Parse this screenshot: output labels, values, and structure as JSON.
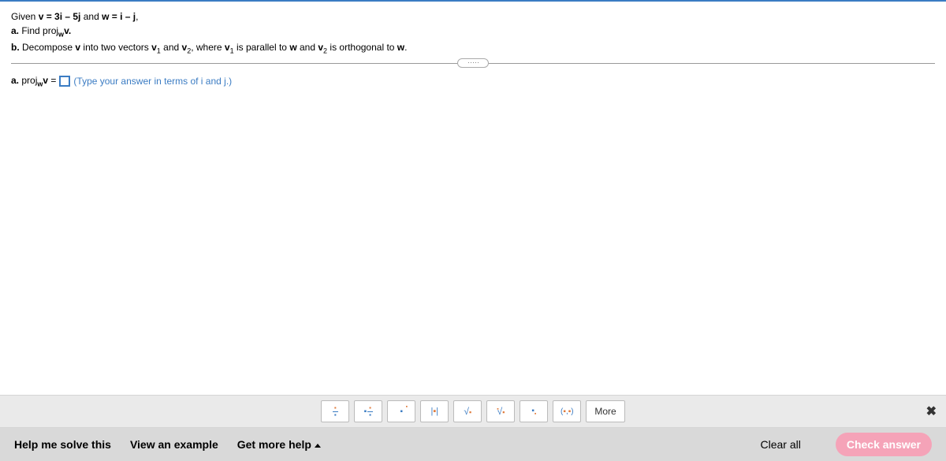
{
  "question": {
    "given_prefix": "Given ",
    "given_v_eq": "v = 3i – 5j",
    "given_and": " and ",
    "given_w_eq": "w = i – j",
    "given_comma": ",",
    "part_a_label": "a.",
    "part_a_text": " Find proj",
    "part_a_sub": "w",
    "part_a_after": "v.",
    "part_b_label": "b.",
    "part_b_text": " Decompose ",
    "v": "v",
    "into": " into two vectors ",
    "v1": "v",
    "v1_sub": "1",
    "and1": " and ",
    "v2": "v",
    "v2_sub": "2",
    "where": ", where ",
    "v1b": "v",
    "v1b_sub": "1",
    "parallel": " is parallel to ",
    "w": "w",
    "and2": " and ",
    "v2b": "v",
    "v2b_sub": "2",
    "orth": " is orthogonal to ",
    "w2": "w",
    "period": "."
  },
  "answer": {
    "label_a": "a.",
    "proj_label": " proj",
    "proj_sub": "w",
    "proj_v": "v",
    "equals": " = ",
    "hint": "(Type your answer in terms of i and j.)"
  },
  "toolbar": {
    "more_label": "More"
  },
  "bottom": {
    "help": "Help me solve this",
    "example": "View an example",
    "more_help": "Get more help",
    "clear": "Clear all",
    "check": "Check answer"
  }
}
